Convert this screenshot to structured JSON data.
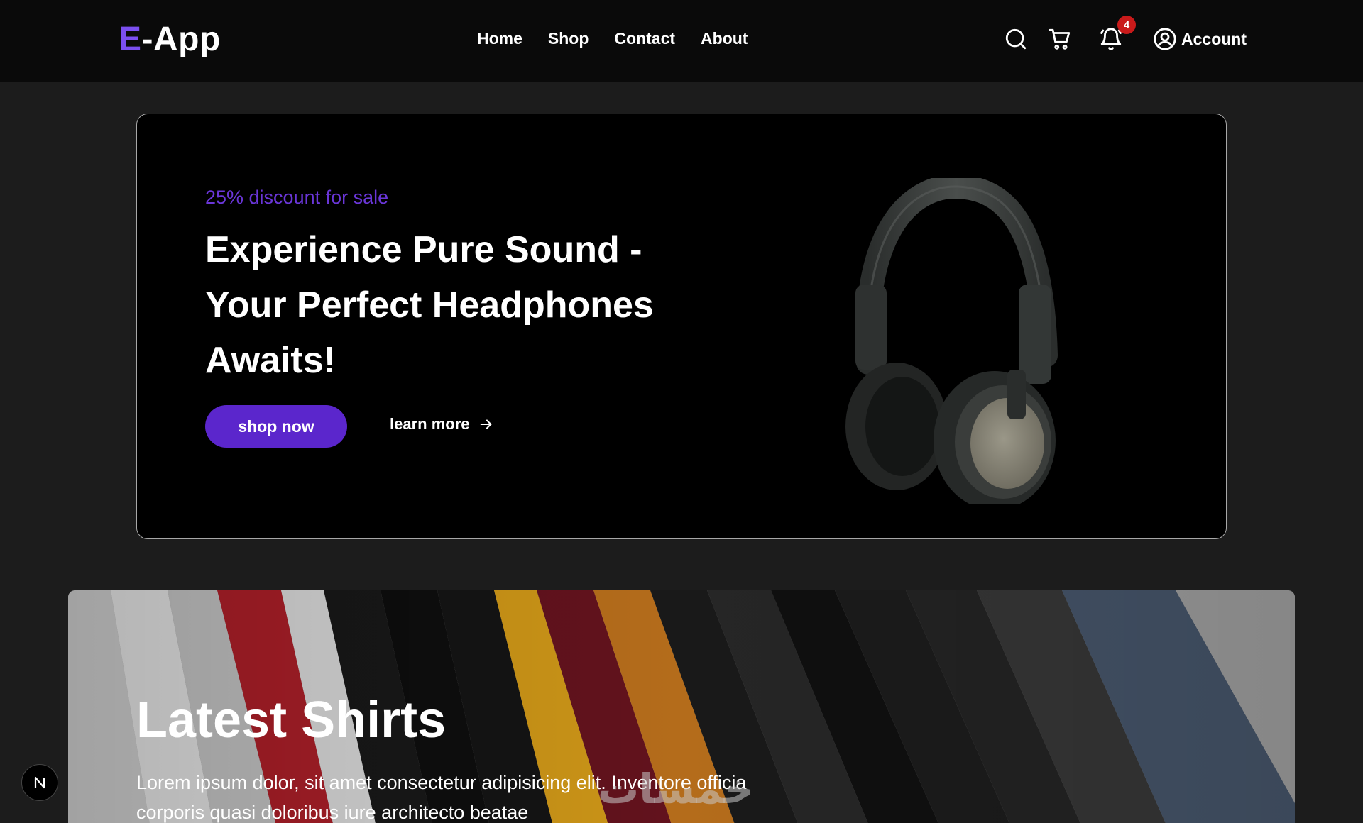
{
  "brand": {
    "logo_prefix": "E",
    "logo_suffix": "-App",
    "accent": "#7b4ff0"
  },
  "nav": {
    "links": [
      "Home",
      "Shop",
      "Contact",
      "About"
    ]
  },
  "header_icons": {
    "search": "search-icon",
    "cart": "cart-icon",
    "notifications": "bell-icon",
    "notification_count": "4",
    "account_label": "Account"
  },
  "hero": {
    "discount": "25% discount for sale",
    "title": "Experience Pure Sound - Your Perfect Headphones Awaits!",
    "primary_button": "shop now",
    "secondary_link": "learn more",
    "primary_color": "#5b26cc",
    "image": "headphones-image"
  },
  "shirts_banner": {
    "title": "Latest Shirts",
    "text": "Lorem ipsum dolor, sit amet consectetur adipisicing elit. Inventore officia corporis quasi doloribus iure architecto beatae",
    "image": "shirts-on-rack-image"
  },
  "watermark": "خمسات",
  "dev_badge": "N"
}
